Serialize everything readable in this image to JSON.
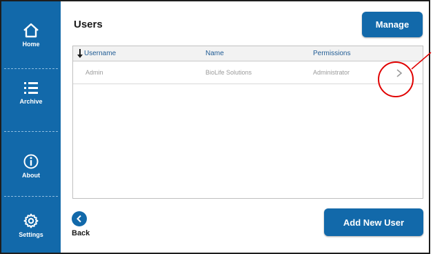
{
  "sidebar": {
    "items": [
      {
        "label": "Home",
        "icon": "home-icon"
      },
      {
        "label": "Archive",
        "icon": "list-icon"
      },
      {
        "label": "About",
        "icon": "info-icon"
      },
      {
        "label": "Settings",
        "icon": "gear-icon"
      }
    ]
  },
  "header": {
    "title": "Users",
    "manage_label": "Manage"
  },
  "table": {
    "columns": [
      "Username",
      "Name",
      "Permissions"
    ],
    "sort_indicator": "sort-down-icon",
    "rows": [
      {
        "username": "Admin",
        "name": "BioLife Solutions",
        "permissions": "Administrator"
      }
    ]
  },
  "footer": {
    "back_label": "Back",
    "add_user_label": "Add New User"
  },
  "colors": {
    "primary": "#1269aa",
    "callout": "#e00000",
    "header_text": "#1f5b94"
  }
}
